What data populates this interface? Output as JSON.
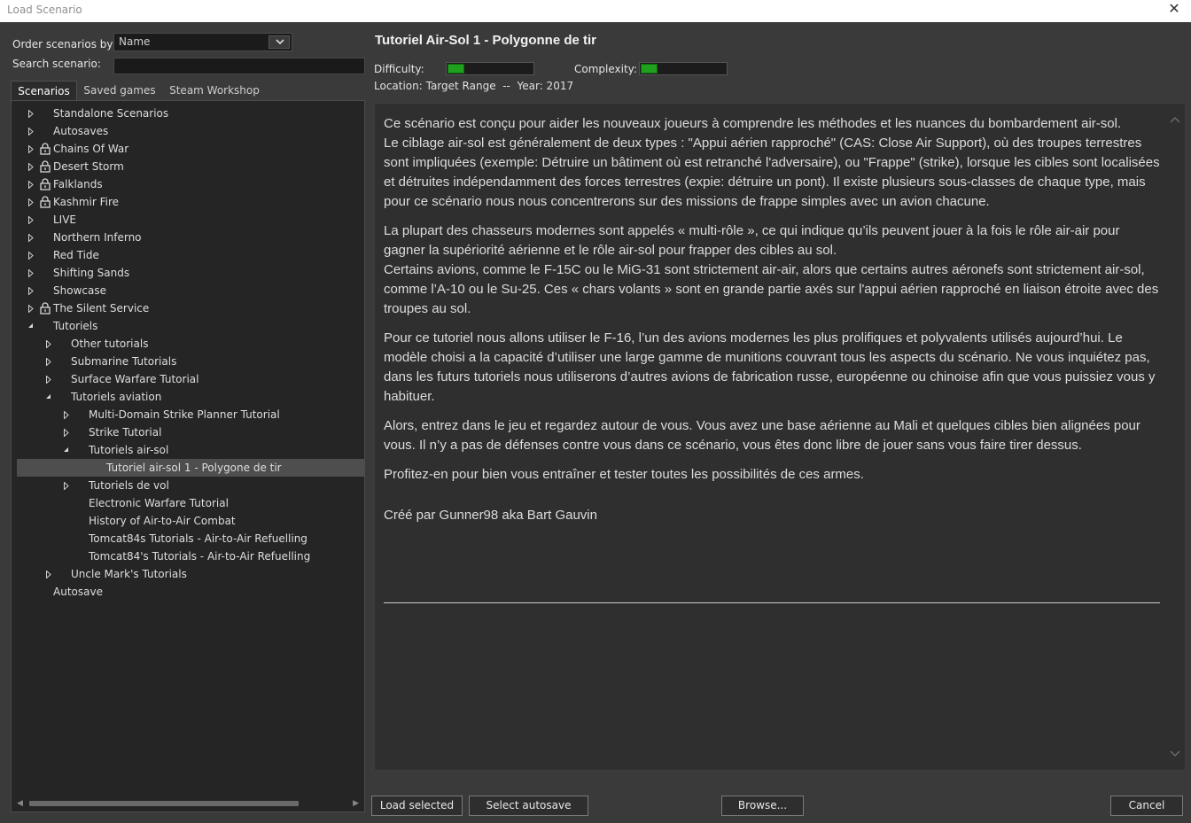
{
  "window": {
    "title": "Load Scenario",
    "close_glyph": "✕"
  },
  "filters": {
    "order_label": "Order scenarios by:",
    "order_value": "Name",
    "search_label": "Search scenario:",
    "search_value": ""
  },
  "tabs": [
    {
      "label": "Scenarios",
      "active": true
    },
    {
      "label": "Saved games",
      "active": false
    },
    {
      "label": "Steam Workshop",
      "active": false
    }
  ],
  "tree": [
    {
      "label": "Standalone Scenarios",
      "level": 0,
      "expander": "collapsed",
      "locked": false
    },
    {
      "label": "Autosaves",
      "level": 0,
      "expander": "collapsed",
      "locked": false
    },
    {
      "label": "Chains Of War",
      "level": 0,
      "expander": "collapsed",
      "locked": true
    },
    {
      "label": "Desert Storm",
      "level": 0,
      "expander": "collapsed",
      "locked": true
    },
    {
      "label": "Falklands",
      "level": 0,
      "expander": "collapsed",
      "locked": true
    },
    {
      "label": "Kashmir Fire",
      "level": 0,
      "expander": "collapsed",
      "locked": true
    },
    {
      "label": "LIVE",
      "level": 0,
      "expander": "collapsed",
      "locked": false
    },
    {
      "label": "Northern Inferno",
      "level": 0,
      "expander": "collapsed",
      "locked": false
    },
    {
      "label": "Red Tide",
      "level": 0,
      "expander": "collapsed",
      "locked": false
    },
    {
      "label": "Shifting Sands",
      "level": 0,
      "expander": "collapsed",
      "locked": false
    },
    {
      "label": "Showcase",
      "level": 0,
      "expander": "collapsed",
      "locked": false
    },
    {
      "label": "The Silent Service",
      "level": 0,
      "expander": "collapsed",
      "locked": true
    },
    {
      "label": "Tutoriels",
      "level": 0,
      "expander": "expanded",
      "locked": false
    },
    {
      "label": "Other tutorials",
      "level": 1,
      "expander": "collapsed",
      "locked": false
    },
    {
      "label": "Submarine Tutorials",
      "level": 1,
      "expander": "collapsed",
      "locked": false
    },
    {
      "label": "Surface Warfare Tutorial",
      "level": 1,
      "expander": "collapsed",
      "locked": false
    },
    {
      "label": "Tutoriels aviation",
      "level": 1,
      "expander": "expanded",
      "locked": false
    },
    {
      "label": "Multi-Domain Strike Planner Tutorial",
      "level": 2,
      "expander": "collapsed",
      "locked": false
    },
    {
      "label": "Strike Tutorial",
      "level": 2,
      "expander": "collapsed",
      "locked": false
    },
    {
      "label": "Tutoriels air-sol",
      "level": 2,
      "expander": "expanded",
      "locked": false
    },
    {
      "label": "Tutoriel air-sol 1 - Polygone de tir",
      "level": 3,
      "expander": "none",
      "locked": false,
      "selected": true
    },
    {
      "label": "Tutoriels de vol",
      "level": 2,
      "expander": "collapsed",
      "locked": false
    },
    {
      "label": "Electronic Warfare Tutorial",
      "level": 2,
      "expander": "none",
      "locked": false
    },
    {
      "label": "History of Air-to-Air Combat",
      "level": 2,
      "expander": "none",
      "locked": false
    },
    {
      "label": "Tomcat84s Tutorials - Air-to-Air Refuelling",
      "level": 2,
      "expander": "none",
      "locked": false
    },
    {
      "label": "Tomcat84's Tutorials - Air-to-Air Refuelling",
      "level": 2,
      "expander": "none",
      "locked": false
    },
    {
      "label": "Uncle Mark's Tutorials",
      "level": 1,
      "expander": "collapsed",
      "locked": false
    },
    {
      "label": "Autosave",
      "level": 0,
      "expander": "none",
      "locked": false
    }
  ],
  "scenario": {
    "title": "Tutoriel Air-Sol 1 - Polygonne de tir",
    "difficulty_label": "Difficulty:",
    "difficulty_level": 0.2,
    "complexity_label": "Complexity:",
    "complexity_level": 0.2,
    "bar_color": "#1fa01f",
    "location_line": "Location: Target Range  --  Year: 2017",
    "paragraphs": [
      "Ce scénario est conçu pour aider les nouveaux joueurs à comprendre les méthodes et les nuances du bombardement air-sol.\nLe ciblage air-sol est généralement de deux types : \"Appui aérien rapproché\" (CAS: Close Air Support), où des troupes terrestres sont impliquées (exemple: Détruire un bâtiment où est retranché l'adversaire), ou \"Frappe\" (strike), lorsque les cibles sont localisées et détruites indépendamment des forces terrestres (expie: détruire un pont). Il existe plusieurs sous-classes de chaque type, mais pour ce scénario nous nous concentrerons sur des missions de frappe simples avec un avion chacune.",
      "La plupart des chasseurs modernes sont appelés « multi-rôle », ce qui indique qu’ils peuvent jouer à la fois le rôle air-air pour gagner la supériorité aérienne et le rôle air-sol pour frapper des cibles au sol.\nCertains avions, comme le F-15C ou le MiG-31 sont strictement air-air, alors que certains autres aéronefs sont strictement air-sol, comme l’A-10 ou le Su-25. Ces « chars volants » sont en grande partie axés sur l'appui aérien rapproché en liaison étroite avec des troupes au sol.",
      "Pour ce tutoriel nous allons utiliser le F-16, l’un des avions modernes les plus prolifiques et polyvalents utilisés aujourd’hui. Le modèle choisi a la capacité d’utiliser une large gamme de munitions couvrant tous les aspects du scénario. Ne vous inquiétez pas, dans les futurs tutoriels nous utiliserons d’autres avions de fabrication russe, européenne ou chinoise afin que vous puissiez vous y habituer.",
      "Alors, entrez dans le jeu et regardez autour de vous. Vous avez une base aérienne au Mali et quelques cibles bien alignées pour vous. Il n’y a pas de défenses contre vous dans ce scénario, vous êtes donc libre de jouer sans vous faire tirer dessus.",
      "Profitez-en pour bien vous entraîner et tester toutes les possibilités de ces armes."
    ],
    "credit": "Créé par Gunner98 aka Bart Gauvin"
  },
  "buttons": {
    "load_selected": "Load selected",
    "select_autosave": "Select autosave",
    "browse": "Browse...",
    "cancel": "Cancel"
  }
}
